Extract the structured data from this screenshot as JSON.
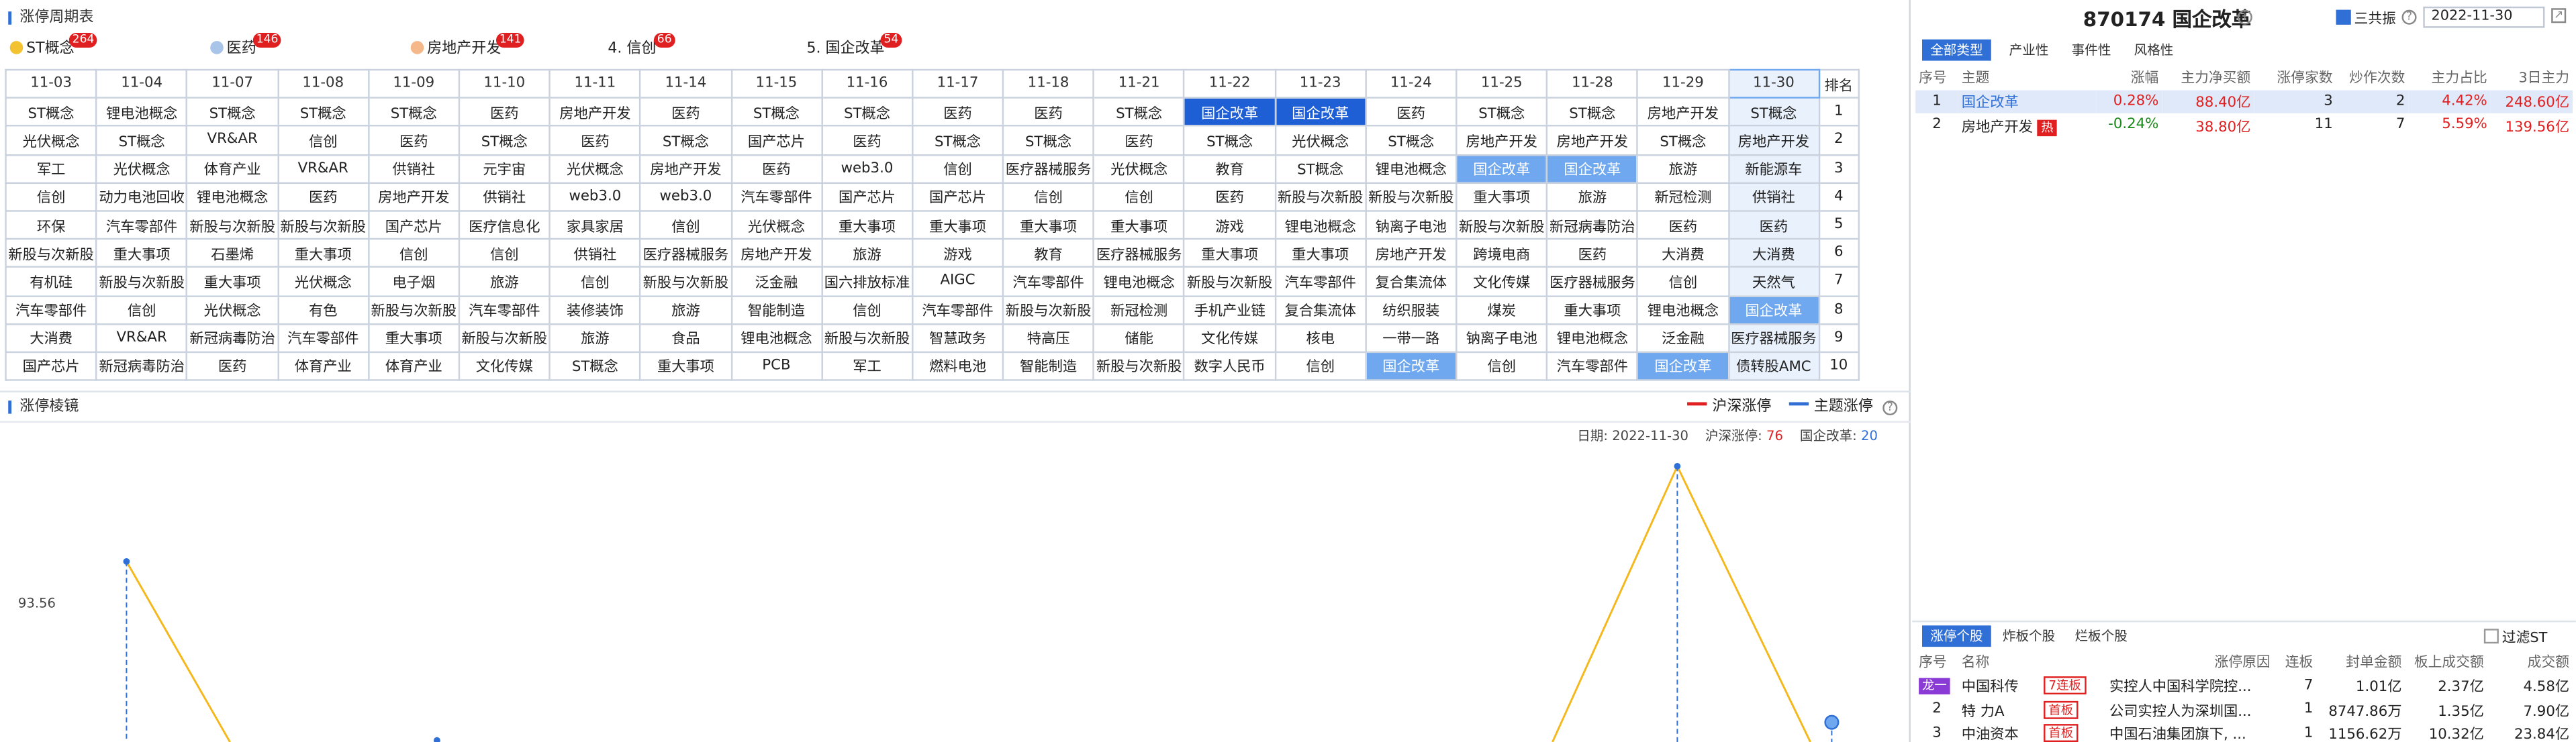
{
  "left_panel": {
    "title": "涨停周期表",
    "topic_tabs": [
      {
        "label": "ST概念",
        "count": "264",
        "dot_color": "#f2c230"
      },
      {
        "label": "医药",
        "count": "146",
        "dot_color": "#a8c4e8"
      },
      {
        "label": "房地产开发",
        "count": "141",
        "dot_color": "#f4b88a"
      },
      {
        "label": "4. 信创",
        "count": "66"
      },
      {
        "label": "5. 国企改革",
        "count": "54"
      }
    ],
    "dates": [
      "11-03",
      "11-04",
      "11-07",
      "11-08",
      "11-09",
      "11-10",
      "11-11",
      "11-14",
      "11-15",
      "11-16",
      "11-17",
      "11-18",
      "11-21",
      "11-22",
      "11-23",
      "11-24",
      "11-25",
      "11-28",
      "11-29",
      "11-30"
    ],
    "rank_header": "排名",
    "rows": [
      {
        "rank": "1",
        "cells": [
          "ST概念",
          "锂电池概念",
          "ST概念",
          "ST概念",
          "ST概念",
          "医药",
          "房地产开发",
          "医药",
          "ST概念",
          "ST概念",
          "医药",
          "医药",
          "ST概念",
          "国企改革",
          "国企改革",
          "医药",
          "ST概念",
          "ST概念",
          "房地产开发",
          "ST概念"
        ]
      },
      {
        "rank": "2",
        "cells": [
          "光伏概念",
          "ST概念",
          "VR&AR",
          "信创",
          "医药",
          "ST概念",
          "医药",
          "ST概念",
          "国产芯片",
          "医药",
          "ST概念",
          "ST概念",
          "医药",
          "ST概念",
          "光伏概念",
          "ST概念",
          "房地产开发",
          "房地产开发",
          "ST概念",
          "房地产开发"
        ]
      },
      {
        "rank": "3",
        "cells": [
          "军工",
          "光伏概念",
          "体育产业",
          "VR&AR",
          "供销社",
          "元宇宙",
          "光伏概念",
          "房地产开发",
          "医药",
          "web3.0",
          "信创",
          "医疗器械服务",
          "光伏概念",
          "教育",
          "ST概念",
          "锂电池概念",
          "国企改革",
          "国企改革",
          "旅游",
          "新能源车"
        ]
      },
      {
        "rank": "4",
        "cells": [
          "信创",
          "动力电池回收",
          "锂电池概念",
          "医药",
          "房地产开发",
          "供销社",
          "web3.0",
          "web3.0",
          "汽车零部件",
          "国产芯片",
          "国产芯片",
          "信创",
          "信创",
          "医药",
          "新股与次新股",
          "新股与次新股",
          "重大事项",
          "旅游",
          "新冠检测",
          "供销社"
        ]
      },
      {
        "rank": "5",
        "cells": [
          "环保",
          "汽车零部件",
          "新股与次新股",
          "新股与次新股",
          "国产芯片",
          "医疗信息化",
          "家具家居",
          "信创",
          "光伏概念",
          "重大事项",
          "重大事项",
          "重大事项",
          "重大事项",
          "游戏",
          "锂电池概念",
          "钠离子电池",
          "新股与次新股",
          "新冠病毒防治",
          "医药",
          "医药"
        ]
      },
      {
        "rank": "6",
        "cells": [
          "新股与次新股",
          "重大事项",
          "石墨烯",
          "重大事项",
          "信创",
          "信创",
          "供销社",
          "医疗器械服务",
          "房地产开发",
          "旅游",
          "游戏",
          "教育",
          "医疗器械服务",
          "重大事项",
          "重大事项",
          "房地产开发",
          "跨境电商",
          "医药",
          "大消费",
          "大消费"
        ]
      },
      {
        "rank": "7",
        "cells": [
          "有机硅",
          "新股与次新股",
          "重大事项",
          "光伏概念",
          "电子烟",
          "旅游",
          "信创",
          "新股与次新股",
          "泛金融",
          "国六排放标准",
          "AIGC",
          "汽车零部件",
          "锂电池概念",
          "新股与次新股",
          "汽车零部件",
          "复合集流体",
          "文化传媒",
          "医疗器械服务",
          "信创",
          "天然气"
        ]
      },
      {
        "rank": "8",
        "cells": [
          "汽车零部件",
          "信创",
          "光伏概念",
          "有色",
          "新股与次新股",
          "汽车零部件",
          "装修装饰",
          "旅游",
          "智能制造",
          "信创",
          "汽车零部件",
          "新股与次新股",
          "新冠检测",
          "手机产业链",
          "复合集流体",
          "纺织服装",
          "煤炭",
          "重大事项",
          "锂电池概念",
          "国企改革"
        ]
      },
      {
        "rank": "9",
        "cells": [
          "大消费",
          "VR&AR",
          "新冠病毒防治",
          "汽车零部件",
          "重大事项",
          "新股与次新股",
          "旅游",
          "食品",
          "锂电池概念",
          "新股与次新股",
          "智慧政务",
          "特高压",
          "储能",
          "文化传媒",
          "核电",
          "一带一路",
          "钠离子电池",
          "锂电池概念",
          "泛金融",
          "医疗器械服务"
        ]
      },
      {
        "rank": "10",
        "cells": [
          "国产芯片",
          "新冠病毒防治",
          "医药",
          "体育产业",
          "体育产业",
          "文化传媒",
          "ST概念",
          "重大事项",
          "PCB",
          "军工",
          "燃料电池",
          "智能制造",
          "新股与次新股",
          "数字人民币",
          "信创",
          "国企改革",
          "信创",
          "汽车零部件",
          "国企改革",
          "债转股AMC"
        ]
      }
    ],
    "highlight_strong": [
      [
        0,
        13
      ],
      [
        0,
        14
      ]
    ],
    "highlight_light": [
      [
        2,
        16
      ],
      [
        2,
        17
      ],
      [
        7,
        19
      ],
      [
        9,
        15
      ],
      [
        9,
        18
      ]
    ]
  },
  "chart_panel": {
    "title": "涨停棱镜",
    "legend": [
      "沪深涨停",
      "主题涨停"
    ],
    "legend_colors": [
      "#e02020",
      "#2f6fd6"
    ],
    "info_date_label": "日期:",
    "info_date": "2022-11-30",
    "info_market_label": "沪深涨停:",
    "info_market": "76",
    "info_topic_label": "国企改革:",
    "info_topic": "20",
    "y_tick": "93.56"
  },
  "right_panel": {
    "code_title": "870174 国企改革",
    "checkbox_label": "三共振",
    "date": "2022-11-30",
    "tabs": [
      "全部类型",
      "产业性",
      "事件性",
      "风格性"
    ],
    "table_headers": [
      "序号",
      "主题",
      "涨幅",
      "主力净买额",
      "涨停家数",
      "炒作次数",
      "主力占比",
      "3日主力"
    ],
    "table_rows": [
      {
        "no": "1",
        "name": "国企改革",
        "hot": "",
        "chg": "0.28%",
        "net": "88.40亿",
        "limit": "3",
        "times": "2",
        "ratio": "4.42%",
        "d3": "248.60亿"
      },
      {
        "no": "2",
        "name": "房地产开发",
        "hot": "热",
        "chg": "-0.24%",
        "net": "38.80亿",
        "limit": "11",
        "times": "7",
        "ratio": "5.59%",
        "d3": "139.56亿"
      }
    ],
    "bottom_tabs": [
      "涨停个股",
      "炸板个股",
      "烂板个股"
    ],
    "filter_label": "过滤ST",
    "stock_headers": [
      "序号",
      "名称",
      "",
      "涨停原因",
      "连板",
      "封单金额",
      "板上成交额",
      "成交额"
    ],
    "stocks": [
      {
        "no": "龙一",
        "name": "中国科传",
        "tag": "7连板",
        "reason": "实控人中国科学院控...",
        "lian": "7",
        "seal": "1.01亿",
        "board": "2.37亿",
        "amount": "4.58亿"
      },
      {
        "no": "2",
        "name": "特 力A",
        "tag": "首板",
        "reason": "公司实控人为深圳国...",
        "lian": "1",
        "seal": "8747.86万",
        "board": "1.35亿",
        "amount": "7.90亿"
      },
      {
        "no": "3",
        "name": "中油资本",
        "tag": "首板",
        "reason": "中国石油集团旗下, ...",
        "lian": "1",
        "seal": "1156.62万",
        "board": "10.32亿",
        "amount": "23.84亿"
      }
    ]
  }
}
